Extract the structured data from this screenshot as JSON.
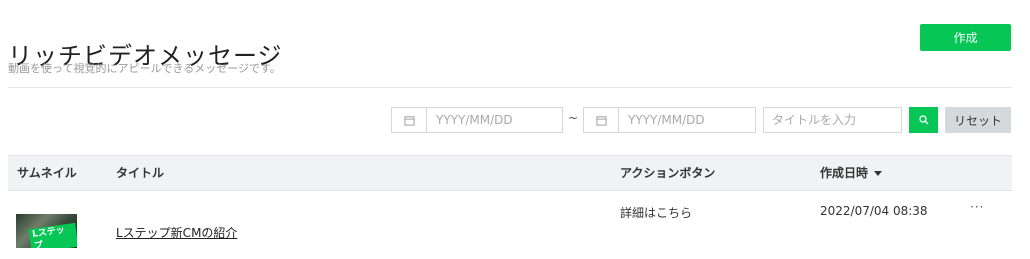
{
  "header": {
    "title": "リッチビデオメッセージ",
    "subtitle": "動画を使って視覚的にアピールできるメッセージです。",
    "create_label": "作成"
  },
  "filters": {
    "date_from_placeholder": "YYYY/MM/DD",
    "separator": "~",
    "date_to_placeholder": "YYYY/MM/DD",
    "title_placeholder": "タイトルを入力",
    "reset_label": "リセット"
  },
  "table": {
    "columns": [
      "サムネイル",
      "タイトル",
      "アクションボタン",
      "作成日時"
    ],
    "rows": [
      {
        "thumbnail_text": "Lステップ",
        "title": "Lステップ新CMの紹介",
        "action_button": "詳細はこちら",
        "created_at": "2022/07/04 08:38",
        "more": "···"
      }
    ]
  },
  "colors": {
    "accent": "#06c755",
    "reset_bg": "#d6d9dc",
    "header_bg": "#f1f2f3"
  },
  "icons": [
    "calendar-icon",
    "search-icon",
    "sort-down-icon",
    "more-icon"
  ]
}
